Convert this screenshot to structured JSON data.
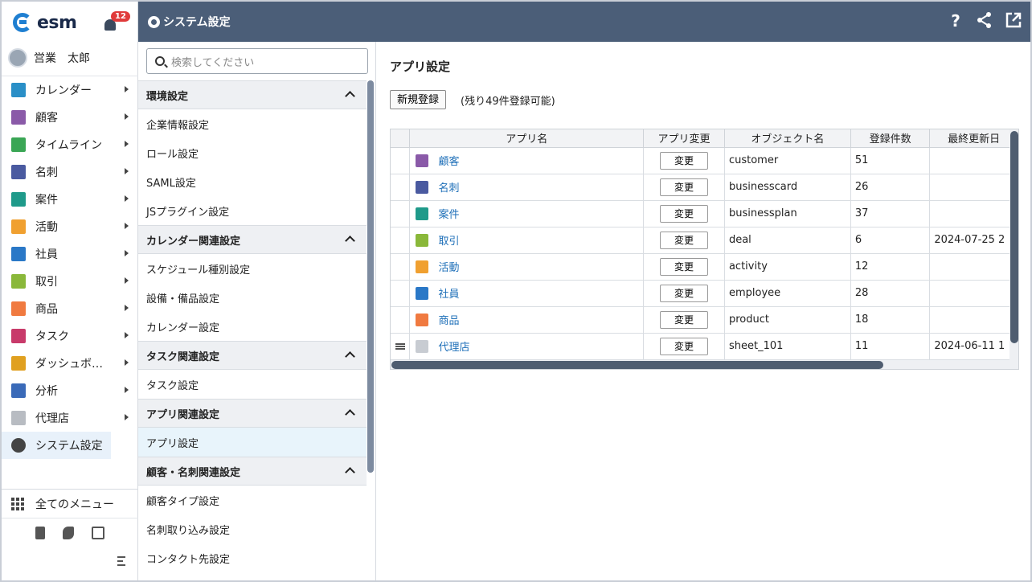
{
  "app": {
    "logo": "esm",
    "notifications": "12"
  },
  "user": {
    "name": "営業　太郎"
  },
  "nav": {
    "items": [
      {
        "label": "カレンダー",
        "icon": "calendar-icon",
        "color": "#2a8fc7"
      },
      {
        "label": "顧客",
        "icon": "building-icon",
        "color": "#8a5aa8"
      },
      {
        "label": "タイムライン",
        "icon": "chat-icon",
        "color": "#3aa655"
      },
      {
        "label": "名刺",
        "icon": "business-card-icon",
        "color": "#4a5aa0"
      },
      {
        "label": "案件",
        "icon": "folder-icon",
        "color": "#1f9a8a"
      },
      {
        "label": "活動",
        "icon": "clipboard-icon",
        "color": "#f0a030"
      },
      {
        "label": "社員",
        "icon": "person-icon",
        "color": "#2a78c7"
      },
      {
        "label": "取引",
        "icon": "deal-icon",
        "color": "#8ab83a"
      },
      {
        "label": "商品",
        "icon": "product-icon",
        "color": "#f07a40"
      },
      {
        "label": "タスク",
        "icon": "task-check-icon",
        "color": "#c83a6a"
      },
      {
        "label": "ダッシュボ…",
        "icon": "dashboard-icon",
        "color": "#e0a020"
      },
      {
        "label": "分析",
        "icon": "chart-icon",
        "color": "#3a6ab8"
      },
      {
        "label": "代理店",
        "icon": "document-icon",
        "color": "#b8bcc2"
      }
    ],
    "active": {
      "label": "システム設定",
      "icon": "gear-icon"
    },
    "all_menu": "全てのメニュー"
  },
  "header": {
    "title": "システム設定"
  },
  "settings_menu": {
    "search_placeholder": "検索してください",
    "sections": [
      {
        "title": "環境設定",
        "items": [
          "企業情報設定",
          "ロール設定",
          "SAML設定",
          "JSプラグイン設定"
        ]
      },
      {
        "title": "カレンダー関連設定",
        "items": [
          "スケジュール種別設定",
          "設備・備品設定",
          "カレンダー設定"
        ]
      },
      {
        "title": "タスク関連設定",
        "items": [
          "タスク設定"
        ]
      },
      {
        "title": "アプリ関連設定",
        "items": [
          "アプリ設定"
        ]
      },
      {
        "title": "顧客・名刺関連設定",
        "items": [
          "顧客タイプ設定",
          "名刺取り込み設定",
          "コンタクト先設定"
        ]
      }
    ],
    "active_item": "アプリ設定"
  },
  "content": {
    "title": "アプリ設定",
    "new_button": "新規登録",
    "remaining": "(残り49件登録可能)",
    "table": {
      "headers": [
        "アプリ名",
        "アプリ変更",
        "オブジェクト名",
        "登録件数",
        "最終更新日"
      ],
      "change_label": "変更",
      "rows": [
        {
          "name": "顧客",
          "icon": "building-icon",
          "color": "#8a5aa8",
          "object": "customer",
          "count": "51",
          "updated": ""
        },
        {
          "name": "名刺",
          "icon": "business-card-icon",
          "color": "#4a5aa0",
          "object": "businesscard",
          "count": "26",
          "updated": ""
        },
        {
          "name": "案件",
          "icon": "folder-icon",
          "color": "#1f9a8a",
          "object": "businessplan",
          "count": "37",
          "updated": ""
        },
        {
          "name": "取引",
          "icon": "deal-icon",
          "color": "#8ab83a",
          "object": "deal",
          "count": "6",
          "updated": "2024-07-25 2"
        },
        {
          "name": "活動",
          "icon": "clipboard-icon",
          "color": "#f0a030",
          "object": "activity",
          "count": "12",
          "updated": ""
        },
        {
          "name": "社員",
          "icon": "person-icon",
          "color": "#2a78c7",
          "object": "employee",
          "count": "28",
          "updated": ""
        },
        {
          "name": "商品",
          "icon": "product-icon",
          "color": "#f07a40",
          "object": "product",
          "count": "18",
          "updated": ""
        },
        {
          "name": "代理店",
          "icon": "document-icon",
          "color": "#c8ccd2",
          "object": "sheet_101",
          "count": "11",
          "updated": "2024-06-11 1",
          "draggable": true
        }
      ]
    }
  }
}
